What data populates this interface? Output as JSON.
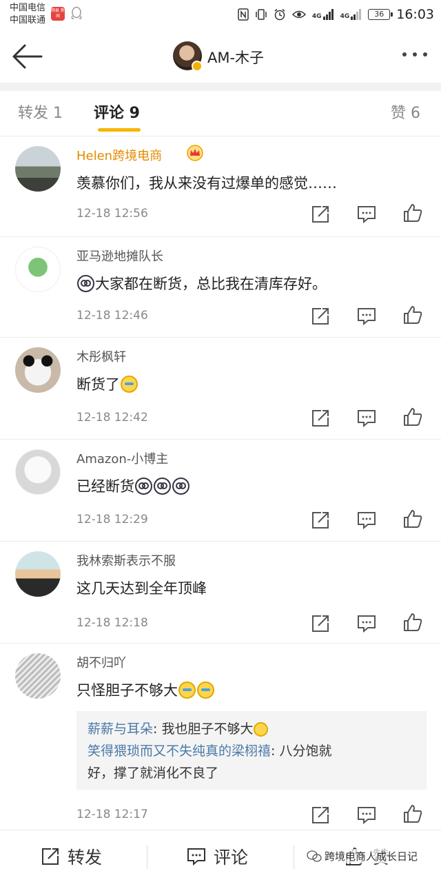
{
  "status_bar": {
    "carrier_1": "中国电信",
    "carrier_2": "中国联通",
    "badge_text": "网易 新闻",
    "network_1": "4G",
    "network_2": "4G",
    "battery": "36",
    "time": "16:03"
  },
  "header": {
    "title": "AM-木子",
    "back_icon": "back-arrow-icon",
    "more_icon": "more-dots-icon"
  },
  "tabs": {
    "repost": "转发 1",
    "comments": "评论 9",
    "likes": "赞 6"
  },
  "comments": [
    {
      "name": "Helen跨境电商",
      "vip": true,
      "text": "羡慕你们，我从来没有过爆单的感觉……",
      "time": "12-18 12:56"
    },
    {
      "name": "亚马逊地摊队长",
      "text": "大家都在断货，总比我在清库存好。",
      "emoji": "dizzy",
      "time": "12-18 12:46"
    },
    {
      "name": "木彤枫轩",
      "text": "断货了",
      "emoji": "cry",
      "time": "12-18 12:42"
    },
    {
      "name": "Amazon-小博主",
      "text": "已经断货",
      "emoji": "dizzy",
      "time": "12-18 12:29"
    },
    {
      "name": "我林索斯表示不服",
      "text": "这几天达到全年顶峰",
      "time": "12-18 12:18"
    },
    {
      "name": "胡不归吖",
      "text": "只怪胆子不够大",
      "emoji": "cry",
      "time": "12-18 12:17",
      "replies": [
        {
          "name": "薪薪与耳朵",
          "text": ": 我也胆子不够大"
        },
        {
          "name": "笑得猥琐而又不失纯真的梁栩禧",
          "text_1": ": 八分饱就",
          "text_2": "好，撑了就消化不良了"
        }
      ]
    }
  ],
  "actions": {
    "repost_icon": "repost-icon",
    "comment_icon": "comment-icon",
    "like_icon": "thumbs-up-icon"
  },
  "bottom_bar": {
    "repost": "转发",
    "comment": "评论",
    "like": "赞"
  },
  "watermark": "跨境电商人成长日记",
  "colors": {
    "accent": "#f7b500",
    "vip_name": "#e38a00",
    "reply_name": "#4a7aa8"
  }
}
